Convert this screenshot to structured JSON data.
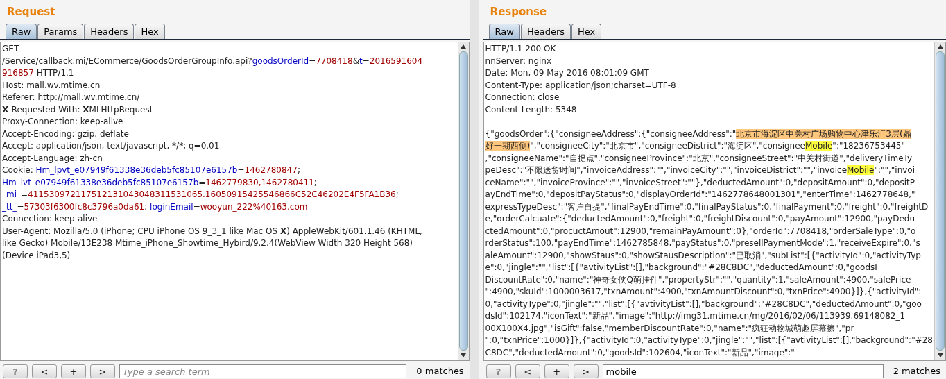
{
  "request": {
    "title": "Request",
    "tabs": [
      {
        "label": "Raw",
        "selected": true
      },
      {
        "label": "Params",
        "selected": false
      },
      {
        "label": "Headers",
        "selected": false
      },
      {
        "label": "Hex",
        "selected": false
      }
    ],
    "lines": [
      [
        {
          "kind": "plain",
          "t": "GET"
        }
      ],
      [
        {
          "kind": "plain",
          "t": "/Service/callback.mi/ECommerce/GoodsOrderGroupInfo.api?"
        },
        {
          "kind": "name",
          "t": "goodsOrderId"
        },
        {
          "kind": "plain",
          "t": "="
        },
        {
          "kind": "value",
          "t": "7708418"
        },
        {
          "kind": "plain",
          "t": "&"
        },
        {
          "kind": "name",
          "t": "t"
        },
        {
          "kind": "plain",
          "t": "="
        },
        {
          "kind": "value",
          "t": "2016591604"
        }
      ],
      [
        {
          "kind": "value",
          "t": "916857"
        },
        {
          "kind": "plain",
          "t": " HTTP/1.1"
        }
      ],
      [
        {
          "kind": "plain",
          "t": "Host: mall.wv.mtime.cn"
        }
      ],
      [
        {
          "kind": "plain",
          "t": "Referer: http://mall.wv.mtime.cn/"
        }
      ],
      [
        {
          "kind": "bold",
          "t": "X"
        },
        {
          "kind": "plain",
          "t": "-Requested-With: "
        },
        {
          "kind": "bold",
          "t": "X"
        },
        {
          "kind": "plain",
          "t": "MLHttpRequest"
        }
      ],
      [
        {
          "kind": "plain",
          "t": "Proxy-Connection: keep-alive"
        }
      ],
      [
        {
          "kind": "plain",
          "t": "Accept-Encoding: gzip, deflate"
        }
      ],
      [
        {
          "kind": "plain",
          "t": "Accept: application/json, text/javascript, */*; q=0.01"
        }
      ],
      [
        {
          "kind": "plain",
          "t": "Accept-Language: zh-cn"
        }
      ],
      [
        {
          "kind": "plain",
          "t": "Cookie: "
        },
        {
          "kind": "name",
          "t": "Hm_lpvt_e07949f61338e36deb5fc85107e6157b"
        },
        {
          "kind": "plain",
          "t": "="
        },
        {
          "kind": "value",
          "t": "1462780847"
        },
        {
          "kind": "plain",
          "t": ";"
        }
      ],
      [
        {
          "kind": "name",
          "t": "Hm_lvt_e07949f61338e36deb5fc85107e6157b"
        },
        {
          "kind": "plain",
          "t": "="
        },
        {
          "kind": "value",
          "t": "1462779830,1462780411"
        },
        {
          "kind": "plain",
          "t": ";"
        }
      ],
      [
        {
          "kind": "name",
          "t": "_mi_"
        },
        {
          "kind": "plain",
          "t": "="
        },
        {
          "kind": "value",
          "t": "411530972117512131043048311531065.16050915425546866C52C46202E4F5FA1B36"
        },
        {
          "kind": "plain",
          "t": ";"
        }
      ],
      [
        {
          "kind": "name",
          "t": "_tt_"
        },
        {
          "kind": "plain",
          "t": "="
        },
        {
          "kind": "value",
          "t": "57303f6300fc8c3796a0da61"
        },
        {
          "kind": "plain",
          "t": "; "
        },
        {
          "kind": "name",
          "t": "loginEmail"
        },
        {
          "kind": "plain",
          "t": "="
        },
        {
          "kind": "value",
          "t": "wooyun_222%40163.com"
        }
      ],
      [
        {
          "kind": "plain",
          "t": "Connection: keep-alive"
        }
      ],
      [
        {
          "kind": "plain",
          "t": "User-Agent: Mozilla/5.0 (iPhone; CPU iPhone OS 9_3_1 like Mac OS "
        },
        {
          "kind": "bold",
          "t": "X"
        },
        {
          "kind": "plain",
          "t": ") AppleWebKit/601.1.46 (KHTML,"
        }
      ],
      [
        {
          "kind": "plain",
          "t": "like Gecko) Mobile/13E238 Mtime_iPhone_Showtime_Hybird/9.2.4(WebView Width 320 Height 568)"
        }
      ],
      [
        {
          "kind": "plain",
          "t": "(Device iPad3,5)"
        }
      ]
    ],
    "search": {
      "buttons": [
        "?",
        "<",
        "+",
        ">"
      ],
      "placeholder": "Type a search term",
      "matches": "0 matches"
    }
  },
  "response": {
    "title": "Response",
    "tabs": [
      {
        "label": "Raw",
        "selected": true
      },
      {
        "label": "Headers",
        "selected": false
      },
      {
        "label": "Hex",
        "selected": false
      }
    ],
    "headers": [
      [
        {
          "kind": "plain",
          "t": "HTTP/1.1 200 OK"
        }
      ],
      [
        {
          "kind": "plain",
          "t": "nnServer: nginx"
        }
      ],
      [
        {
          "kind": "plain",
          "t": "Date: Mon, 09 May 2016 08:01:09 GMT"
        }
      ],
      [
        {
          "kind": "plain",
          "t": "Content-Type: application/json;charset=UTF-8"
        }
      ],
      [
        {
          "kind": "plain",
          "t": "Connection: close"
        }
      ],
      [
        {
          "kind": "plain",
          "t": "Content-Length: 5348"
        }
      ]
    ],
    "body": [
      [
        {
          "kind": "plain",
          "t": "{\"goodsOrder\":{\"consigneeAddress\":{\"consigneeAddress\":\""
        },
        {
          "kind": "selection",
          "t": "北京市海淀区中关村广场购物中心津乐汇3层(鼎"
        }
      ],
      [
        {
          "kind": "selection",
          "t": "好一期西侧)"
        },
        {
          "kind": "plain",
          "t": "\",\"consigneeCity\":\"北京市\",\"consigneeDistrict\":\"海淀区\",\"consignee"
        },
        {
          "kind": "match",
          "t": "Mobile"
        },
        {
          "kind": "plain",
          "t": "\":\"18236753445\""
        }
      ],
      [
        {
          "kind": "plain",
          "t": ",\"consigneeName\":\"自提点\",\"consigneeProvince\":\"北京\",\"consigneeStreet\":\"中关村街道\",\"deliveryTimeTy"
        }
      ],
      [
        {
          "kind": "plain",
          "t": "peDesc\":\"不限送货时间\",\"invoiceAddress\":\"\",\"invoiceCity\":\"\",\"invoiceDistrict\":\"\",\"invoice"
        },
        {
          "kind": "match",
          "t": "Mobile"
        },
        {
          "kind": "plain",
          "t": "\":\"\",\"invoi"
        }
      ],
      [
        {
          "kind": "plain",
          "t": "ceName\":\"\",\"invoiceProvince\":\"\",\"invoiceStreet\":\"\"},\"deductedAmount\":0,\"depositAmount\":0,\"depositP"
        }
      ],
      [
        {
          "kind": "plain",
          "t": "ayEndTime\":0,\"depositPayStatus\":0,\"displayOrderId\":\"1462778648001301\",\"enterTime\":1462778648,\""
        }
      ],
      [
        {
          "kind": "plain",
          "t": "expressTypeDesc\":\"客户自提\",\"finalPayEndTime\":0,\"finalPayStatus\":0,\"finalPayment\":0,\"freight\":0,\"freightD"
        }
      ],
      [
        {
          "kind": "plain",
          "t": "e,\"orderCalcuate\":{\"deductedAmount\":0,\"freight\":0,\"freightDiscount\":0,\"payAmount\":12900,\"payDedu"
        }
      ],
      [
        {
          "kind": "plain",
          "t": "ctedAmount\":0,\"procuctAmout\":12900,\"remainPayAmount\":0},\"orderId\":7708418,\"orderSaleType\":0,\"o"
        }
      ],
      [
        {
          "kind": "plain",
          "t": "rderStatus\":100,\"payEndTime\":1462785848,\"payStatus\":0,\"presellPaymentMode\":1,\"receiveExpire\":0,\"s"
        }
      ],
      [
        {
          "kind": "plain",
          "t": "aleAmount\":12900,\"showStaus\":0,\"showStausDescription\":\"已取消\",\"subList\":[{\"activityId\":0,\"activityTyp"
        }
      ],
      [
        {
          "kind": "plain",
          "t": "e\":0,\"jingle\":\"\",\"list\":[{\"avtivityList\":[],\"background\":\"#28C8DC\",\"deductedAmount\":0,\"goodsI"
        }
      ],
      [
        {
          "kind": "plain",
          "t": "DiscountRate\":0,\"name\":\"神奇女侠Q萌挂件\",\"propertyStr\":\"\",\"quantity\":1,\"saleAmount\":4900,\"salePrice"
        }
      ],
      [
        {
          "kind": "plain",
          "t": "\":4900,\"skuId\":1000003617,\"txnAmount\":4900,\"txnAmountDiscount\":0,\"txnPrice\":4900}]},{\"activityId\":"
        }
      ],
      [
        {
          "kind": "plain",
          "t": "0,\"activityType\":0,\"jingle\":\"\",\"list\":[{\"avtivityList\":[],\"background\":\"#28C8DC\",\"deductedAmount\":0,\"goo"
        }
      ],
      [
        {
          "kind": "plain",
          "t": "dsId\":102174,\"iconText\":\"新品\",\"image\":\"http://img31.mtime.cn/mg/2016/02/06/113939.69148082_1"
        }
      ],
      [
        {
          "kind": "plain",
          "t": "00X100X4.jpg\",\"isGift\":false,\"memberDiscountRate\":0,\"name\":\"疯狂动物城萌趣屏幕擦\",\"pr"
        }
      ],
      [
        {
          "kind": "plain",
          "t": "\":0,\"txnPrice\":1000}]},{\"activityId\":0,\"activityType\":0,\"jingle\":\"\",\"list\":[{\"avtivityList\":[],\"background\":\"#28"
        }
      ],
      [
        {
          "kind": "plain",
          "t": "C8DC\",\"deductedAmount\":0,\"goodsId\":102604,\"iconText\":\"新品\",\"image\":\""
        }
      ]
    ],
    "search": {
      "buttons": [
        "?",
        "<",
        "+",
        ">"
      ],
      "value": "mobile",
      "matches": "2 matches"
    }
  }
}
